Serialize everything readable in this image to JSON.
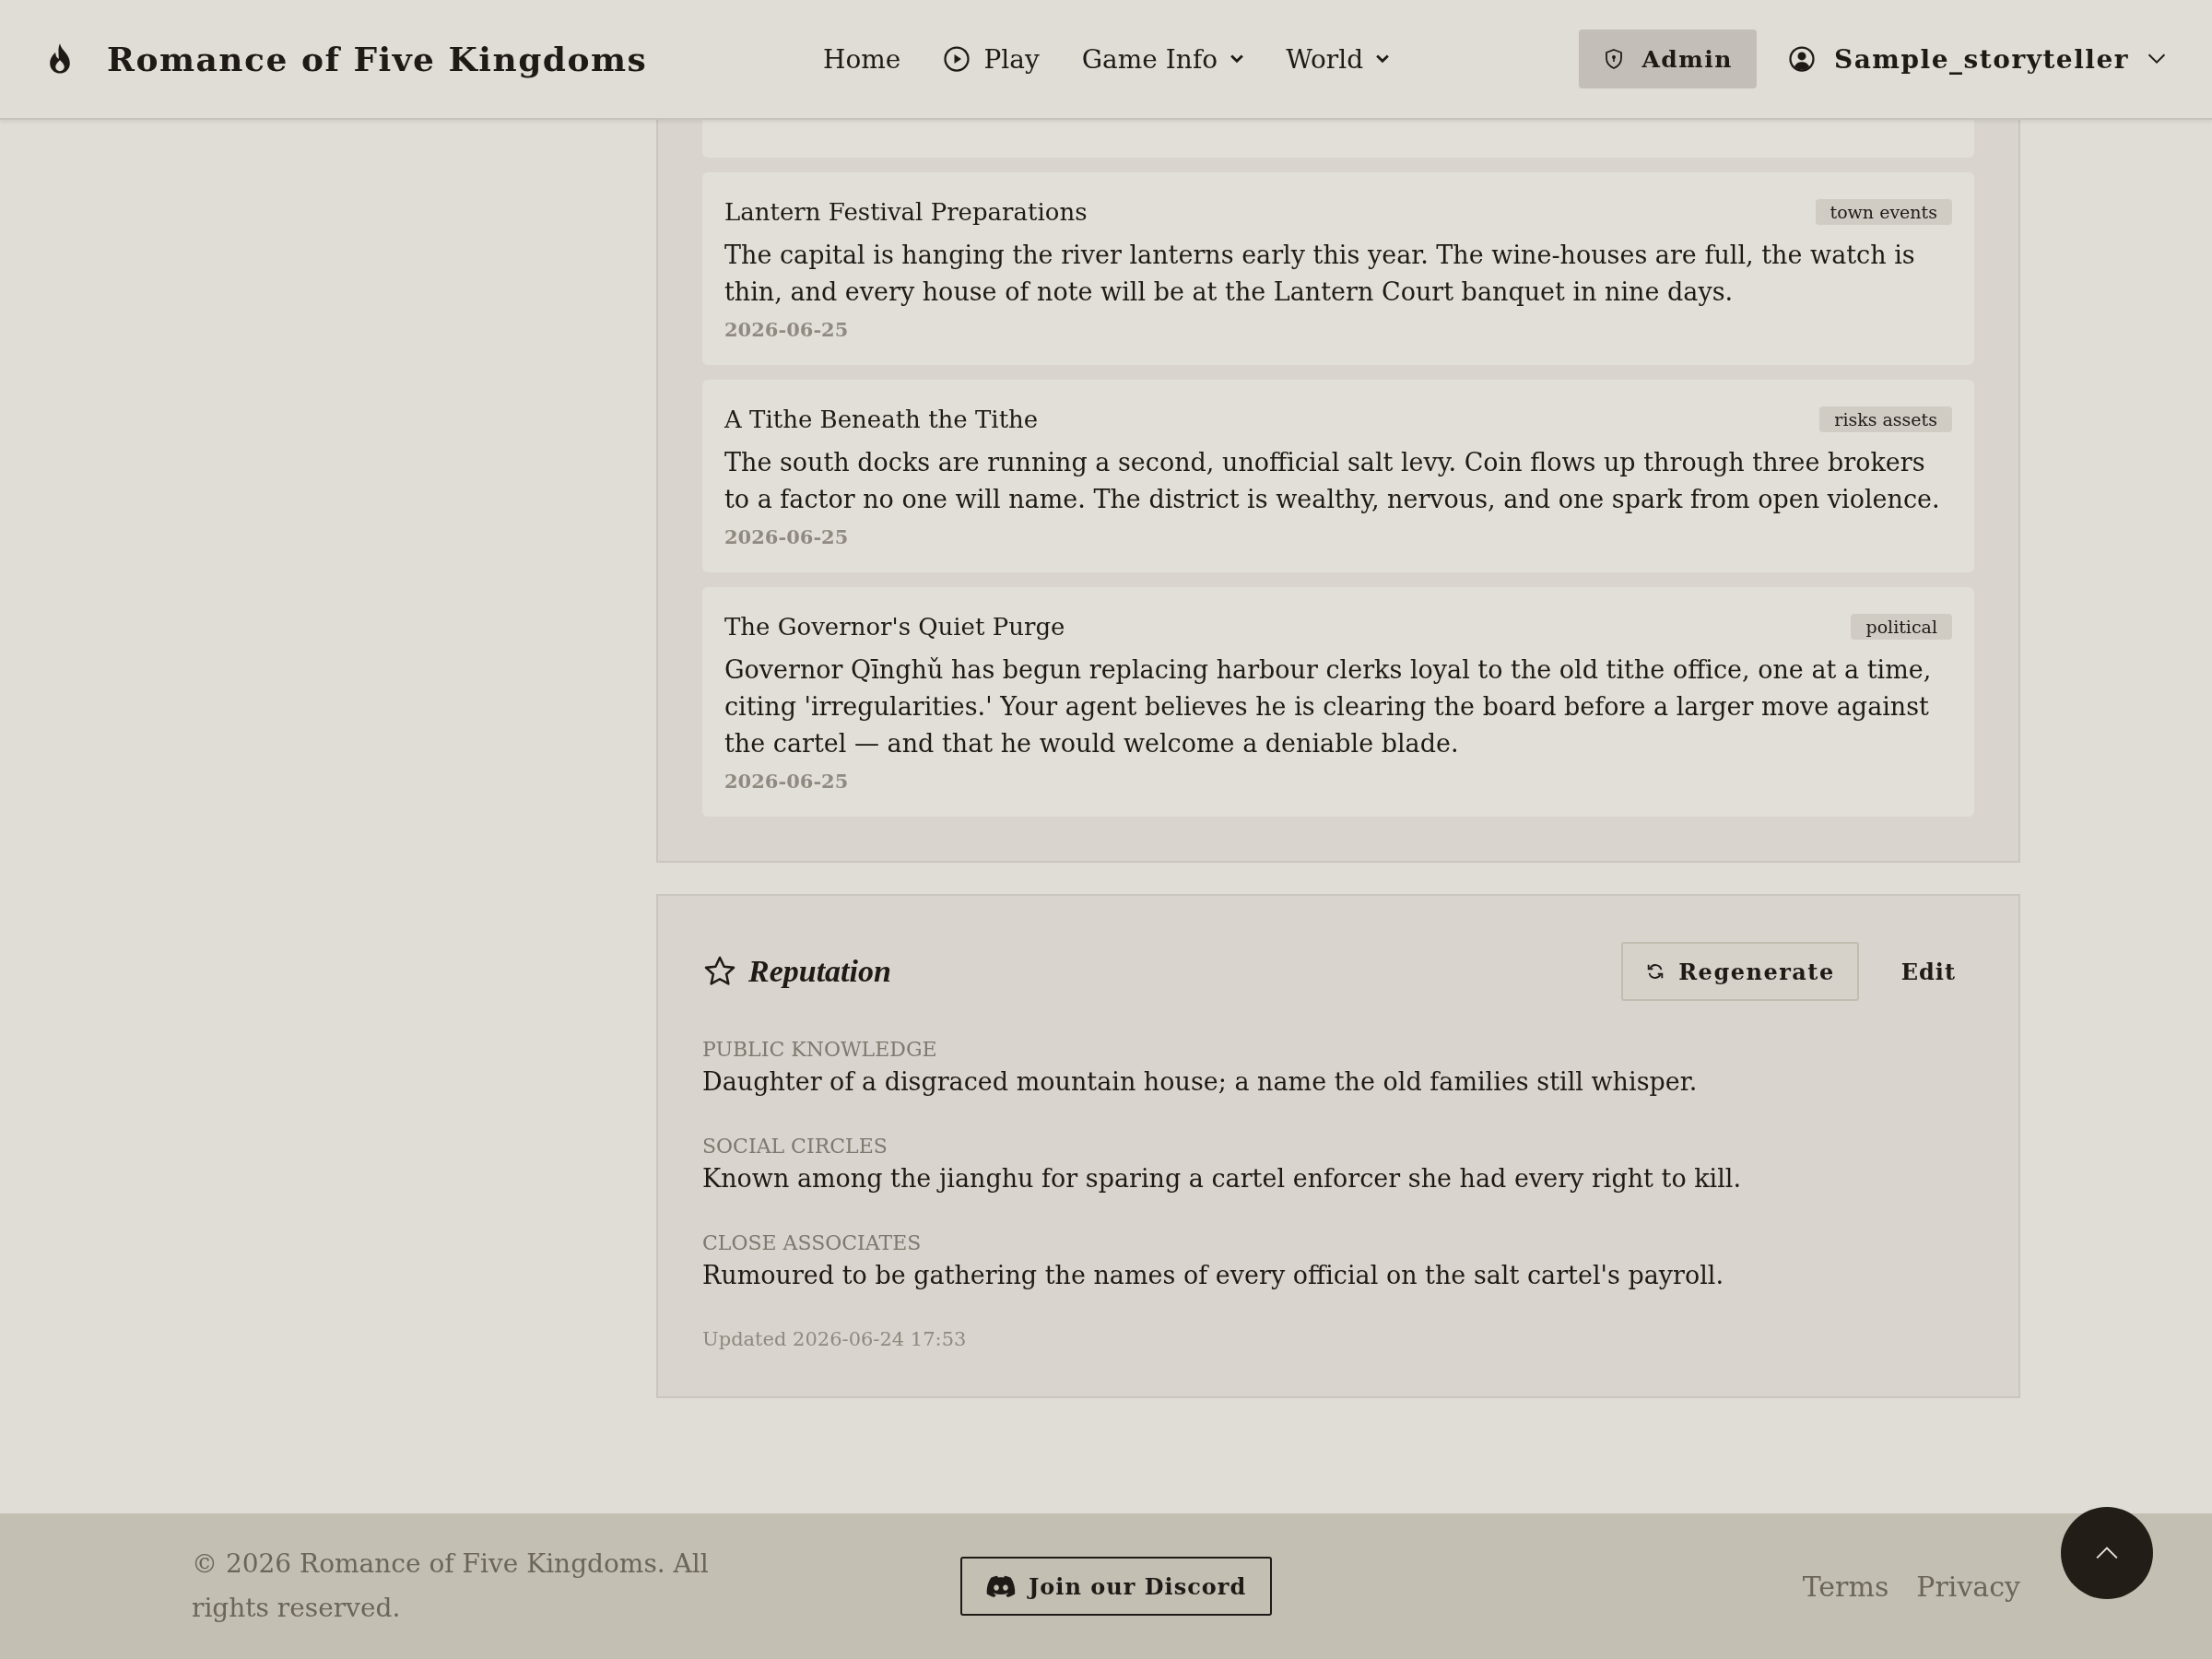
{
  "header": {
    "logo": "Romance of Five Kingdoms",
    "nav": [
      {
        "label": "Home",
        "kind": "link"
      },
      {
        "label": "Play",
        "kind": "play"
      },
      {
        "label": "Game Info",
        "kind": "dropdown"
      },
      {
        "label": "World",
        "kind": "dropdown"
      }
    ],
    "admin": "Admin",
    "user": "Sample_storyteller"
  },
  "events": [
    {
      "title": "Lantern Festival Preparations",
      "tag": "town events",
      "body": "The capital is hanging the river lanterns early this year. The wine-houses are full, the watch is thin, and every house of note will be at the Lantern Court banquet in nine days.",
      "date": "2026-06-25"
    },
    {
      "title": "A Tithe Beneath the Tithe",
      "tag": "risks assets",
      "body": "The south docks are running a second, unofficial salt levy. Coin flows up through three brokers to a factor no one will name. The district is wealthy, nervous, and one spark from open violence.",
      "date": "2026-06-25"
    },
    {
      "title": "The Governor's Quiet Purge",
      "tag": "political",
      "body": "Governor Qīnghǔ has begun replacing harbour clerks loyal to the old tithe office, one at a time, citing 'irregularities.' Your agent believes he is clearing the board before a larger move against the cartel — and that he would welcome a deniable blade.",
      "date": "2026-06-25"
    }
  ],
  "reputation": {
    "title": "Reputation",
    "regenerate": "Regenerate",
    "edit": "Edit",
    "sections": [
      {
        "label": "PUBLIC KNOWLEDGE",
        "text": "Daughter of a disgraced mountain house; a name the old families still whisper."
      },
      {
        "label": "SOCIAL CIRCLES",
        "text": "Known among the jianghu for sparing a cartel enforcer she had every right to kill."
      },
      {
        "label": "CLOSE ASSOCIATES",
        "text": "Rumoured to be gathering the names of every official on the salt cartel's payroll."
      }
    ],
    "updated": "Updated 2026-06-24 17:53"
  },
  "footer": {
    "copyright": "© 2026 Romance of Five Kingdoms. All rights reserved.",
    "discord": "Join our Discord",
    "links": [
      "Terms",
      "Privacy"
    ]
  }
}
